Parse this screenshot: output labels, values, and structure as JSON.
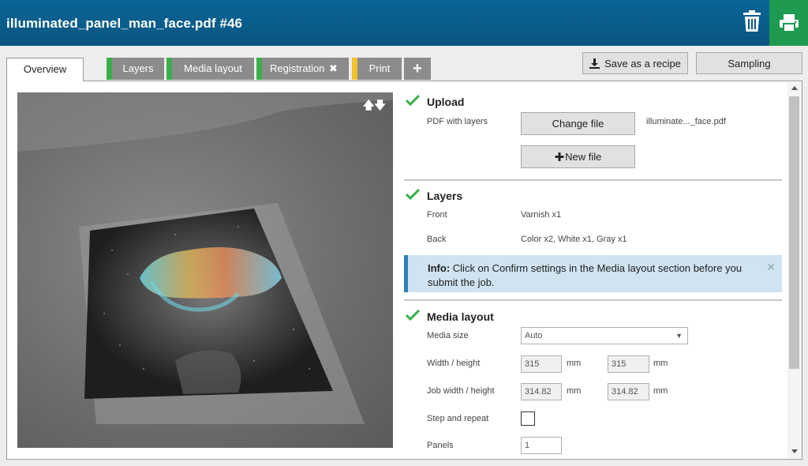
{
  "header": {
    "title": "illuminated_panel_man_face.pdf #46",
    "trash_icon": "trash-icon",
    "print_icon": "printer-icon"
  },
  "tabs": [
    {
      "label": "Overview",
      "active": true
    },
    {
      "label": "Layers",
      "status_color": "#3aae4a"
    },
    {
      "label": "Media layout",
      "status_color": "#3aae4a"
    },
    {
      "label": "Registration",
      "status_color": "#3aae4a",
      "icon": "close-icon"
    },
    {
      "label": "Print",
      "status_color": "#f2c12e"
    },
    {
      "label": "+",
      "icon": "plus-icon"
    }
  ],
  "toolbar": {
    "save_recipe": "Save as a recipe",
    "sampling": "Sampling"
  },
  "preview": {
    "sort_icons": "up-down-arrows-icon"
  },
  "upload": {
    "title": "Upload",
    "pdf_label": "PDF with layers",
    "change_file": "Change file",
    "file_name": "illuminate..._face.pdf",
    "new_file": "New file"
  },
  "layers": {
    "title": "Layers",
    "front_label": "Front",
    "front_value": "Varnish x1",
    "back_label": "Back",
    "back_value": "Color x2, White x1, Gray x1"
  },
  "info": {
    "prefix": "Info:",
    "text": "Click on Confirm settings in the Media layout section before you submit the job."
  },
  "media_layout": {
    "title": "Media layout",
    "media_size_label": "Media size",
    "media_size_value": "Auto",
    "width_height_label": "Width / height",
    "width_value": "315",
    "height_value": "315",
    "job_wh_label": "Job width / height",
    "job_width_value": "314.82",
    "job_height_value": "314.82",
    "unit": "mm",
    "step_repeat_label": "Step and repeat",
    "panels_label": "Panels",
    "panels_value": "1"
  },
  "colors": {
    "header": "#08557f",
    "print_button": "#1e9b50",
    "ok_check": "#3aae4a",
    "info_bg": "#cfe3f1"
  }
}
